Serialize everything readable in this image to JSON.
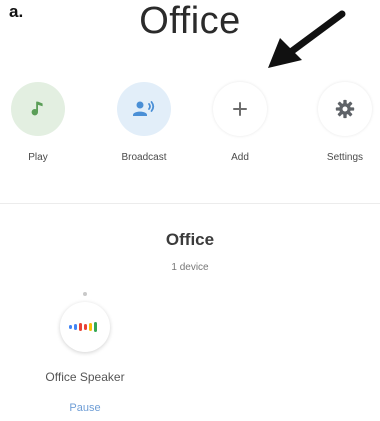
{
  "panel_label": "a.",
  "room": {
    "title": "Office"
  },
  "actions": [
    {
      "label": "Play",
      "icon": "music-note-icon",
      "bg": "#e3efe1",
      "fg": "#5b9e58"
    },
    {
      "label": "Broadcast",
      "icon": "broadcast-icon",
      "bg": "#e2eef9",
      "fg": "#4a8fd6"
    },
    {
      "label": "Add",
      "icon": "plus-icon",
      "bg": "#ffffff",
      "fg": "#6d6d6d"
    },
    {
      "label": "Settings",
      "icon": "gear-icon",
      "bg": "#ffffff",
      "fg": "#5f6368"
    }
  ],
  "devices_section": {
    "title": "Office",
    "subtitle": "1 device"
  },
  "device": {
    "name": "Office Speaker",
    "action_label": "Pause",
    "icon": "speaker-equalizer-icon",
    "colors": [
      "#4285f4",
      "#ea4335",
      "#fbbc05",
      "#34a853"
    ]
  }
}
